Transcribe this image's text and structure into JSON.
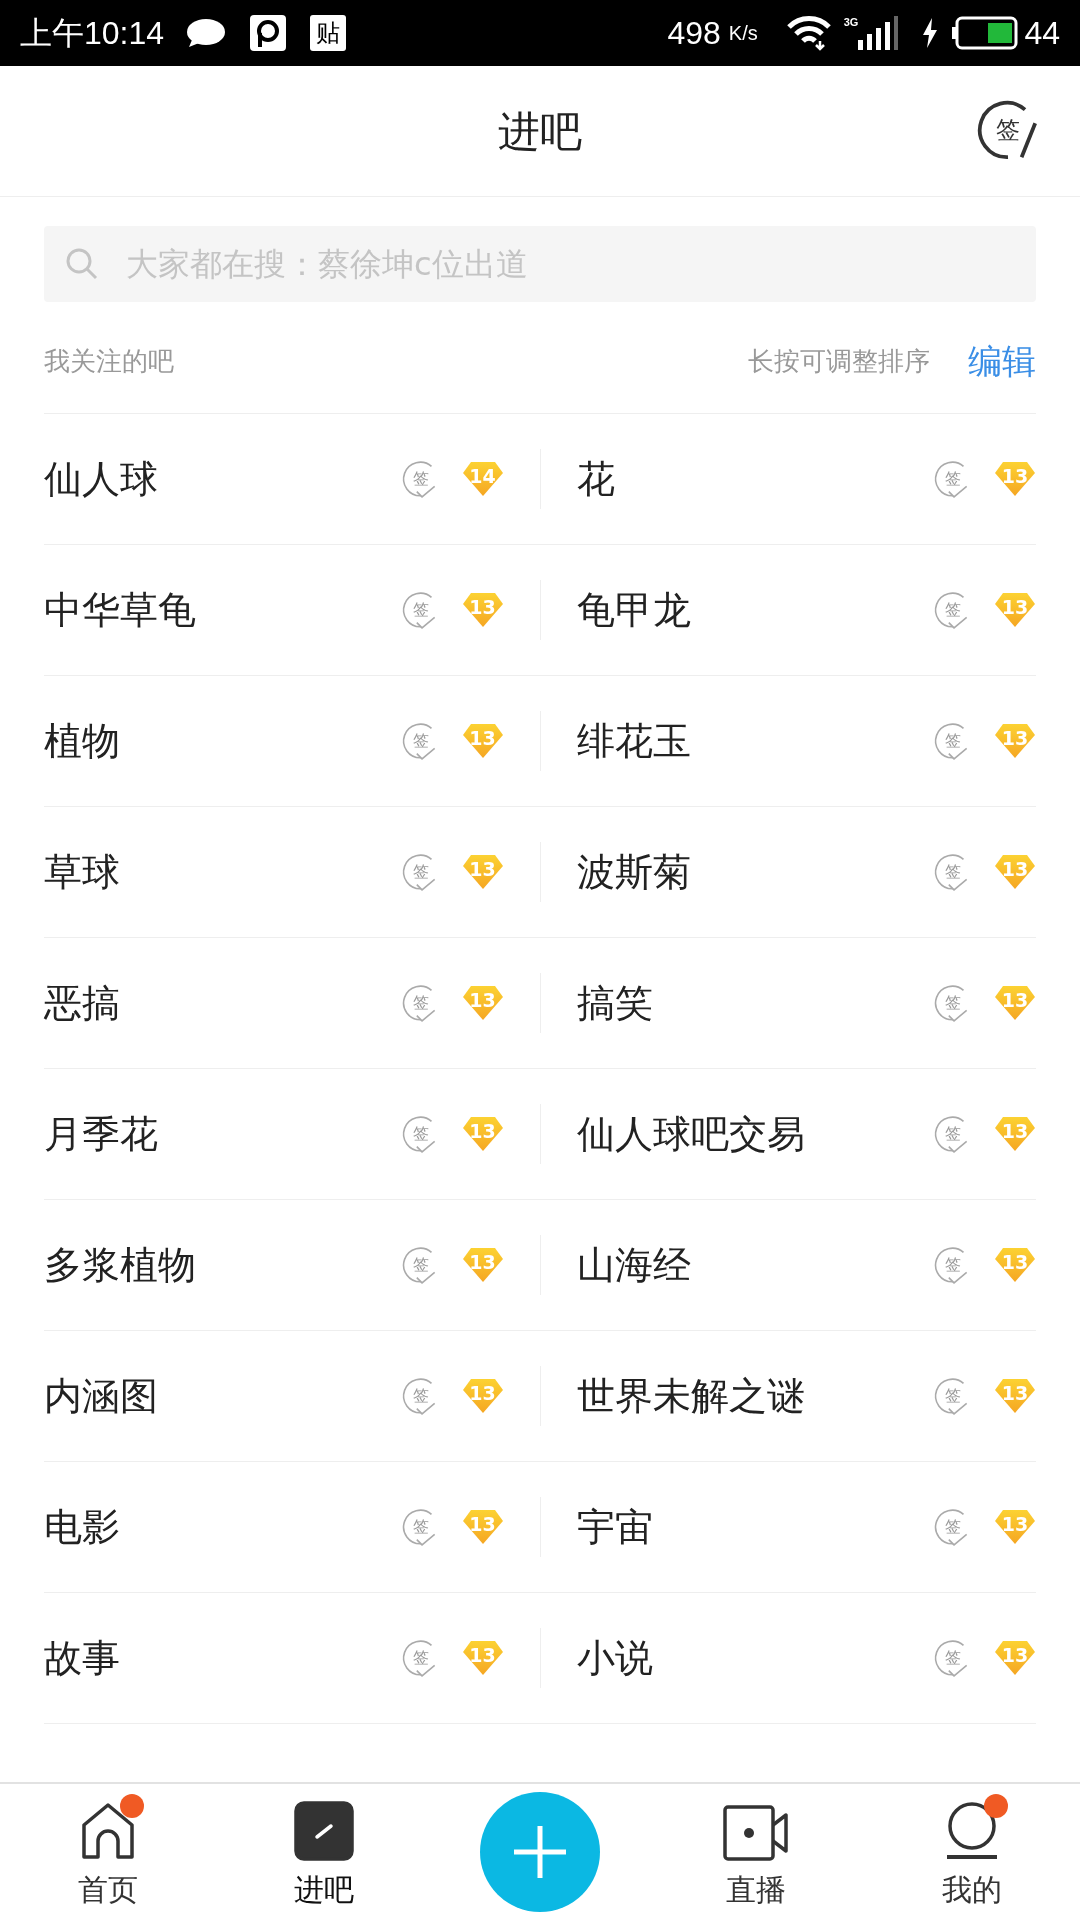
{
  "status_bar": {
    "time": "上午10:14",
    "tieba_glyph": "贴",
    "speed": "498",
    "speed_unit": "K/s",
    "network": "3G",
    "battery": "44"
  },
  "header": {
    "title": "进吧",
    "sign_label": "签"
  },
  "search": {
    "placeholder": "大家都在搜：蔡徐坤c位出道"
  },
  "section": {
    "title": "我关注的吧",
    "hint": "长按可调整排序",
    "edit": "编辑"
  },
  "forums": [
    {
      "name": "仙人球",
      "sign_label": "签",
      "grade": "14"
    },
    {
      "name": "花",
      "sign_label": "签",
      "grade": "13"
    },
    {
      "name": "中华草龟",
      "sign_label": "签",
      "grade": "13"
    },
    {
      "name": "龟甲龙",
      "sign_label": "签",
      "grade": "13"
    },
    {
      "name": "植物",
      "sign_label": "签",
      "grade": "13"
    },
    {
      "name": "绯花玉",
      "sign_label": "签",
      "grade": "13"
    },
    {
      "name": "草球",
      "sign_label": "签",
      "grade": "13"
    },
    {
      "name": "波斯菊",
      "sign_label": "签",
      "grade": "13"
    },
    {
      "name": "恶搞",
      "sign_label": "签",
      "grade": "13"
    },
    {
      "name": "搞笑",
      "sign_label": "签",
      "grade": "13"
    },
    {
      "name": "月季花",
      "sign_label": "签",
      "grade": "13"
    },
    {
      "name": "仙人球吧交易",
      "sign_label": "签",
      "grade": "13"
    },
    {
      "name": "多浆植物",
      "sign_label": "签",
      "grade": "13"
    },
    {
      "name": "山海经",
      "sign_label": "签",
      "grade": "13"
    },
    {
      "name": "内涵图",
      "sign_label": "签",
      "grade": "13"
    },
    {
      "name": "世界未解之谜",
      "sign_label": "签",
      "grade": "13"
    },
    {
      "name": "电影",
      "sign_label": "签",
      "grade": "13"
    },
    {
      "name": "宇宙",
      "sign_label": "签",
      "grade": "13"
    },
    {
      "name": "故事",
      "sign_label": "签",
      "grade": "13"
    },
    {
      "name": "小说",
      "sign_label": "签",
      "grade": "13"
    }
  ],
  "tabs": [
    {
      "kind": "home",
      "label": "首页",
      "selected": false,
      "dot": true
    },
    {
      "kind": "forums",
      "label": "进吧",
      "selected": true,
      "dot": false
    },
    {
      "kind": "post",
      "selected": false
    },
    {
      "kind": "live",
      "label": "直播",
      "selected": false,
      "dot": false
    },
    {
      "kind": "me",
      "label": "我的",
      "selected": false,
      "dot": true
    }
  ]
}
